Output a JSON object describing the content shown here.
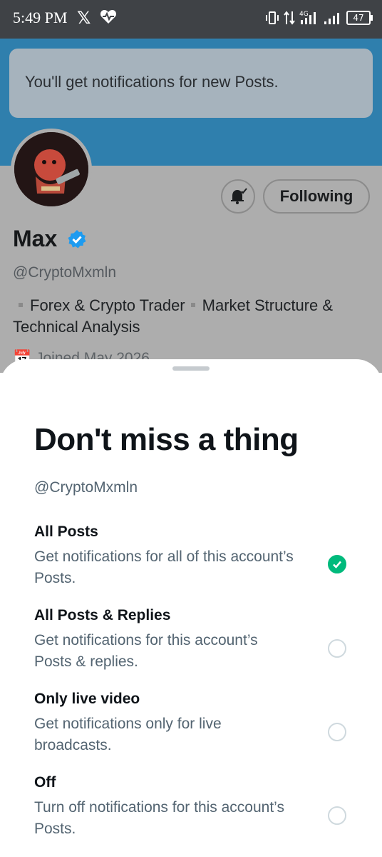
{
  "status_bar": {
    "time": "5:49 PM",
    "app_icon": "x-logo-icon",
    "network": "4G",
    "battery": "47"
  },
  "toast": {
    "message": "You'll get notifications for new Posts."
  },
  "profile": {
    "name": "Max",
    "handle": "@CryptoMxmln",
    "bio_part1": "Forex & Crypto Trader",
    "bio_part2": "Market Structure &",
    "bio_part3": "Technical Analysis",
    "joined": "Joined May 2026",
    "following_label": "Following"
  },
  "sheet": {
    "title": "Don't miss a thing",
    "handle": "@CryptoMxmln",
    "options": [
      {
        "title": "All Posts",
        "description": "Get notifications for all of this account’s Posts.",
        "selected": true
      },
      {
        "title": "All Posts & Replies",
        "description": "Get notifications for this account’s Posts & replies.",
        "selected": false
      },
      {
        "title": "Only live video",
        "description": "Get notifications only for live broadcasts.",
        "selected": false
      },
      {
        "title": "Off",
        "description": "Turn off notifications for this account’s Posts.",
        "selected": false
      }
    ]
  },
  "colors": {
    "status_bar": "#3f4246",
    "banner": "#2f7fad",
    "selected_radio": "#00ba7c",
    "verified": "#1d9bf0"
  }
}
